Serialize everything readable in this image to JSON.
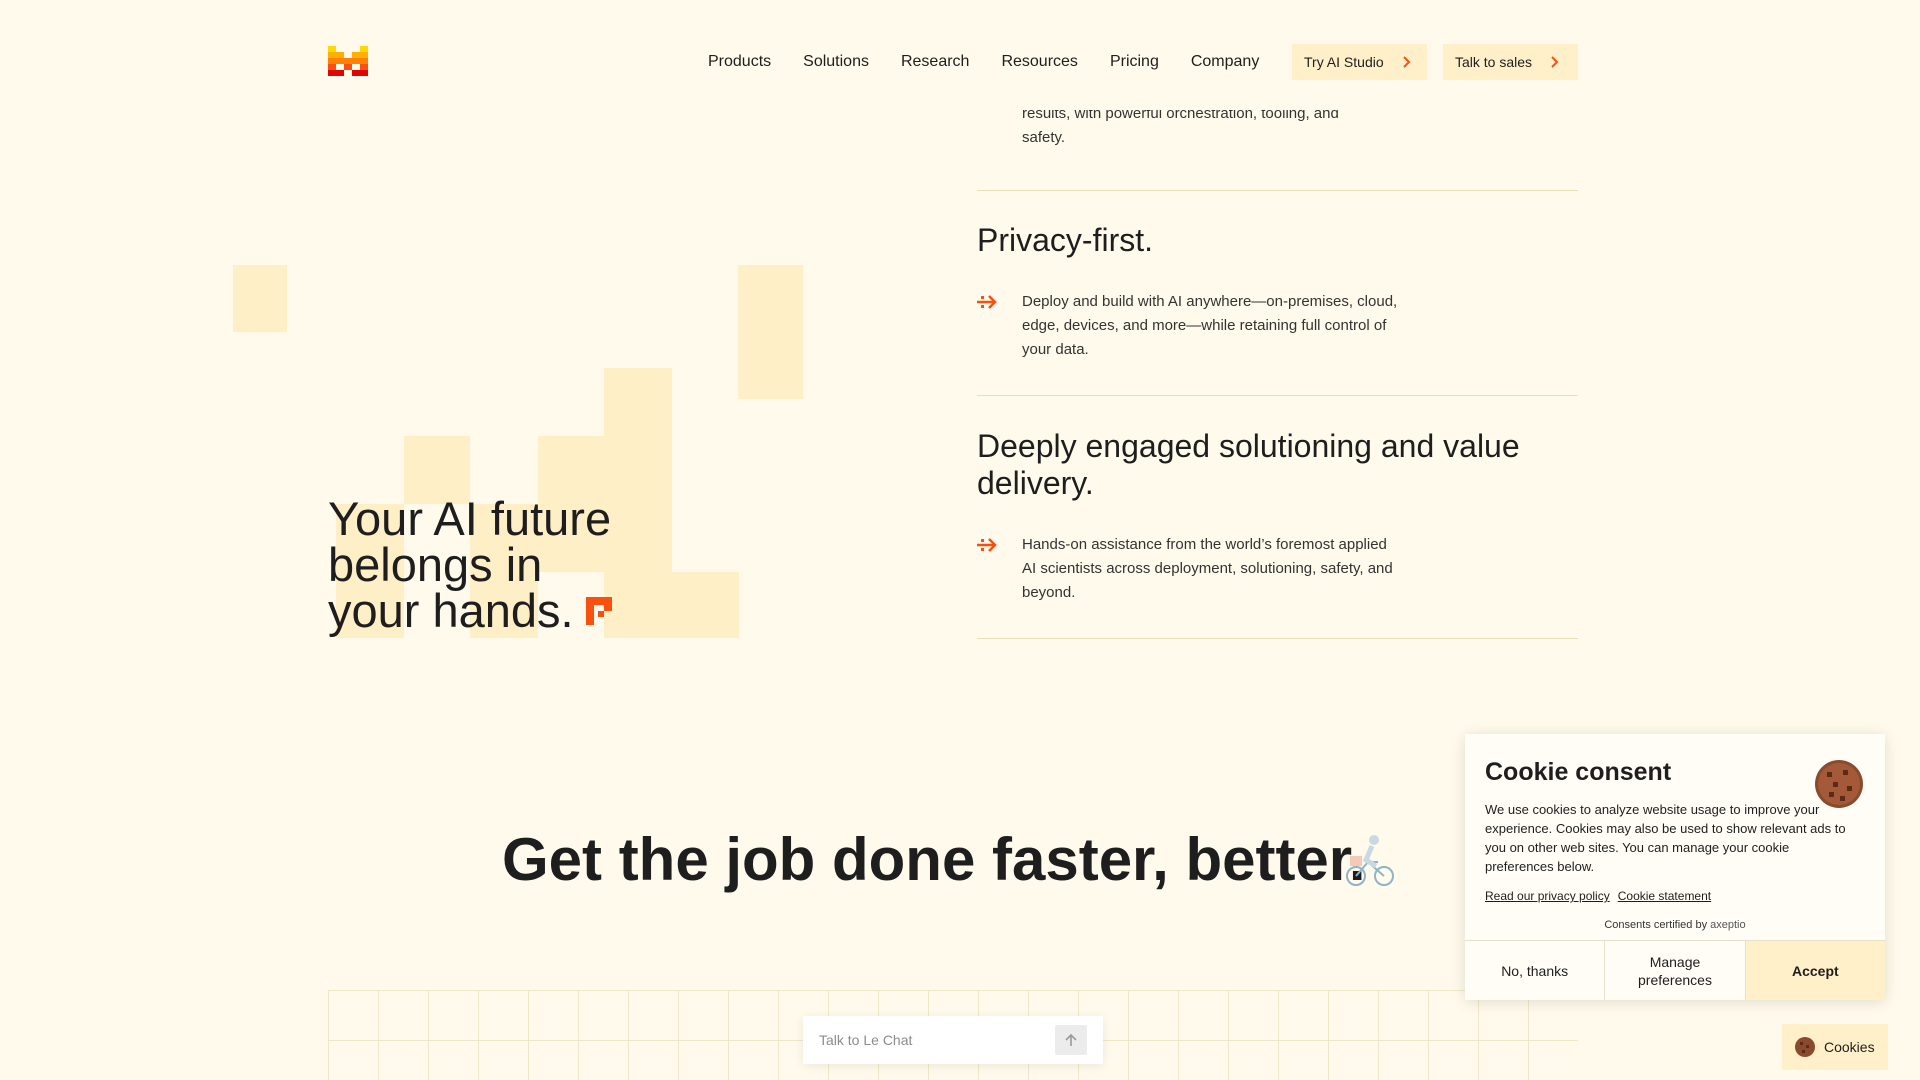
{
  "header": {
    "nav": [
      "Products",
      "Solutions",
      "Research",
      "Resources",
      "Pricing",
      "Company"
    ],
    "try_studio": "Try AI Studio",
    "talk_sales": "Talk to sales"
  },
  "hero": {
    "title_line1": "Your AI future",
    "title_line2": "belongs in",
    "title_line3": "your hands."
  },
  "features": {
    "top_cut_text": "results, with powerful orchestration, tooling, and safety.",
    "items": [
      {
        "title": "Privacy-first.",
        "text": "Deploy and build with AI anywhere—on-premises, cloud, edge, devices, and more—while retaining full control of your data."
      },
      {
        "title": "Deeply engaged solutioning and value delivery.",
        "text": "Hands-on assistance from the world’s foremost applied AI scientists across deployment, solutioning, safety, and beyond."
      }
    ]
  },
  "section2": {
    "title": "Get the job done faster, better."
  },
  "chat": {
    "placeholder": "Talk to Le Chat"
  },
  "cookie": {
    "title": "Cookie consent",
    "text": "We use cookies to analyze website usage to improve your experience. Cookies may also be used to show relevant ads to you on other web sites. You can manage your cookie preferences below.",
    "privacy_link": "Read our privacy policy",
    "statement_link": "Cookie statement",
    "certified": "Consents certified by",
    "certifier": "axeptio",
    "no_thanks": "No, thanks",
    "manage": "Manage preferences",
    "accept": "Accept",
    "pill": "Cookies"
  },
  "colors": {
    "background": "#fffaeb",
    "accent_orange": "#fa500f",
    "block_yellow": "#ffefc6",
    "button_bg": "#fff0c9"
  }
}
